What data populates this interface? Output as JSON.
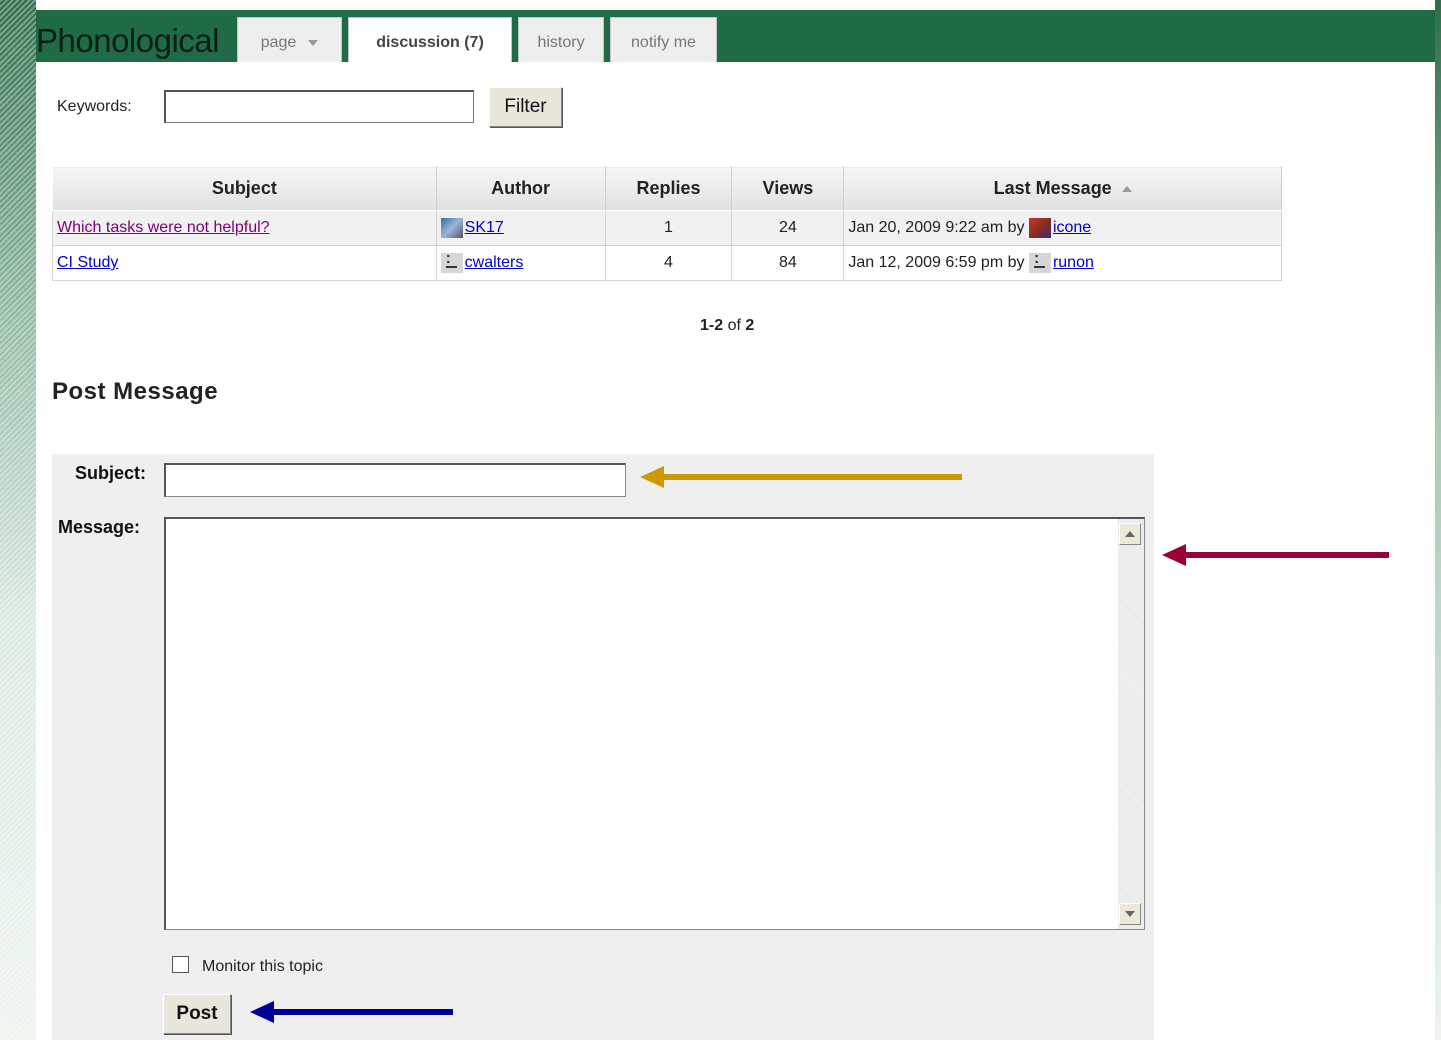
{
  "header": {
    "site_title": "Phonological",
    "tabs": {
      "page": "page",
      "discussion": "discussion (7)",
      "history": "history",
      "notify": "notify me"
    }
  },
  "filter": {
    "keywords_label": "Keywords:",
    "keywords_value": "",
    "filter_button": "Filter"
  },
  "table": {
    "headers": [
      "Subject",
      "Author",
      "Replies",
      "Views",
      "Last Message"
    ],
    "rows": [
      {
        "subject": "Which tasks were not helpful?",
        "author": "SK17",
        "replies": "1",
        "views": "24",
        "last_date": "Jan 20, 2009 9:22 am by",
        "last_author": "icone"
      },
      {
        "subject": "CI Study",
        "author": "cwalters",
        "replies": "4",
        "views": "84",
        "last_date": "Jan 12, 2009 6:59 pm by",
        "last_author": "runon"
      }
    ]
  },
  "pager": {
    "from": "1",
    "dash": "-",
    "to": "2",
    "of": " of ",
    "total": "2"
  },
  "post": {
    "heading": "Post Message",
    "subject_label": "Subject:",
    "subject_value": "",
    "message_label": "Message:",
    "message_value": "",
    "monitor_label": "Monitor this topic",
    "monitor_checked": false,
    "post_button": "Post"
  },
  "annotations": {
    "arrow_subject_color": "#cc9900",
    "arrow_message_color": "#990033",
    "arrow_post_color": "#000099"
  }
}
